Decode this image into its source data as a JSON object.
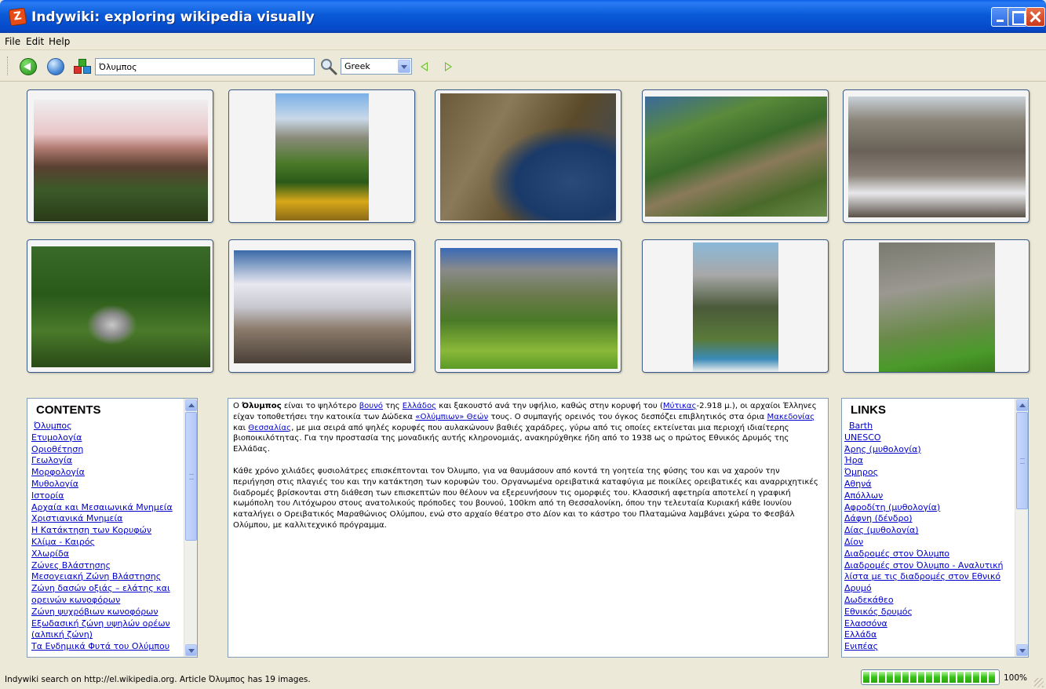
{
  "window": {
    "title": "Indywiki: exploring wikipedia visually"
  },
  "menu": {
    "file": "File",
    "edit": "Edit",
    "help": "Help"
  },
  "toolbar": {
    "search_value": "Όλυμπος",
    "language": "Greek",
    "icons": [
      "back-icon",
      "globe-icon",
      "cubes-icon",
      "search-icon",
      "prev-arrow-icon",
      "next-arrow-icon"
    ]
  },
  "contents": {
    "title": "CONTENTS",
    "items": [
      "Όλυμπος",
      "Ετυμολογία",
      "Οριοθέτηση",
      "Γεωλογία",
      "Μορφολογία",
      "Μυθολογία",
      "Ιστορία",
      "Αρχαία και Μεσαιωνικά Μνημεία",
      "Χριστιανικά Μνημεία",
      "Η Κατάκτηση των Κορυφών",
      "Κλίμα - Καιρός",
      "Χλωρίδα",
      "Ζώνες Βλάστησης",
      "Μεσογειακή Ζώνη Βλάστησης",
      "Ζώνη δασών οξιάς – ελάτης και",
      "ορεινών κωνοφόρων",
      "Ζώνη ψυχρόβιων κωνοφόρων",
      "Εξωδασική ζώνη υψηλών ορέων",
      "(αλπική ζώνη)",
      "Τα Ενδημικά Φυτά του Ολύμπου"
    ]
  },
  "article": {
    "p1": {
      "t1": "Ο ",
      "bold": "Όλυμπος",
      "t2": " είναι το ψηλότερο ",
      "l1": "βουνό",
      "t3": " της ",
      "l2": "Ελλάδος",
      "t4": " και ξακουστό ανά την υφήλιο, καθώς στην κορυφή του (",
      "l3": "Μύτικας",
      "t5": "-2.918 μ.), οι αρχαίοι Έλληνες είχαν τοποθετήσει την κατοικία των Δώδεκα ",
      "l4": "«Ολύμπιων» Θεών",
      "t6": " τους. Ο συμπαγής ορεινός του όγκος δεσπόζει επιβλητικός στα όρια ",
      "l5": "Μακεδονίας",
      "t7": " και ",
      "l6": "Θεσσαλίας",
      "t8": ", με μια σειρά από ψηλές κορυφές που αυλακώνουν βαθιές χαράδρες, γύρω από τις οποίες εκτείνεται μια περιοχή ιδιαίτερης βιοποικιλότητας. Για την προστασία της μοναδικής αυτής κληρονομιάς, ανακηρύχθηκε ήδη από το 1938 ως ο πρώτος Εθνικός Δρυμός της Ελλάδας."
    },
    "p2": "Κάθε χρόνο χιλιάδες φυσιολάτρες επισκέπτονται τον Όλυμπο, για να θαυμάσουν από κοντά τη γοητεία της φύσης του και να χαρούν την περιήγηση στις πλαγιές του και την κατάκτηση των κορυφών του. Οργανωμένα ορειβατικά καταφύγια με ποικίλες ορειβατικές και αναρριχητικές διαδρομές βρίσκονται στη διάθεση των επισκεπτών που θέλουν να εξερευνήσουν τις ομορφιές του. Κλασσική αφετηρία αποτελεί η γραφική κωμόπολη του Λιτόχωρου στους ανατολικούς πρόποδες του βουνού, 100km από τη Θεσσαλονίκη, όπου την τελευταία Κυριακή κάθε Ιουνίου καταλήγει ο Ορειβατικός Μαραθώνιος Ολύμπου, ενώ στο αρχαίο θέατρο στο Δίον και το κάστρο του Πλαταμώνα λαμβάνει χώρα το Φεσβάλ Ολύμπου, με καλλιτεχνικό πρόγραμμα."
  },
  "links": {
    "title": "LINKS",
    "items": [
      "Barth",
      "UNESCO",
      "Άρης (μυθολογία)",
      "Ήρα",
      "Όμηρος",
      "Αθηνά",
      "Απόλλων",
      "Αφροδίτη (μυθολογία)",
      "Δάφνη (δένδρο)",
      "Δίας (μυθολογία)",
      "Δίον",
      "Διαδρομές στον Όλυμπο",
      "Διαδρομές στον Όλυμπο - Αναλυτική",
      "λίστα με τις διαδρομές στον Εθνικό",
      "Δρυμό",
      "Δωδεκάθεο",
      "Εθνικός δρυμός",
      "Ελασσόνα",
      "Ελλάδα",
      "Ενιπέας"
    ]
  },
  "status": {
    "text": "Indywiki search on http://el.wikipedia.org. Article Όλυμπος has 19 images.",
    "progress_label": "100%",
    "progress_fraction": 1.0
  },
  "colors": {
    "link": "#0000cc",
    "titlebar": "#0a5ad8",
    "progress": "#36c216"
  }
}
